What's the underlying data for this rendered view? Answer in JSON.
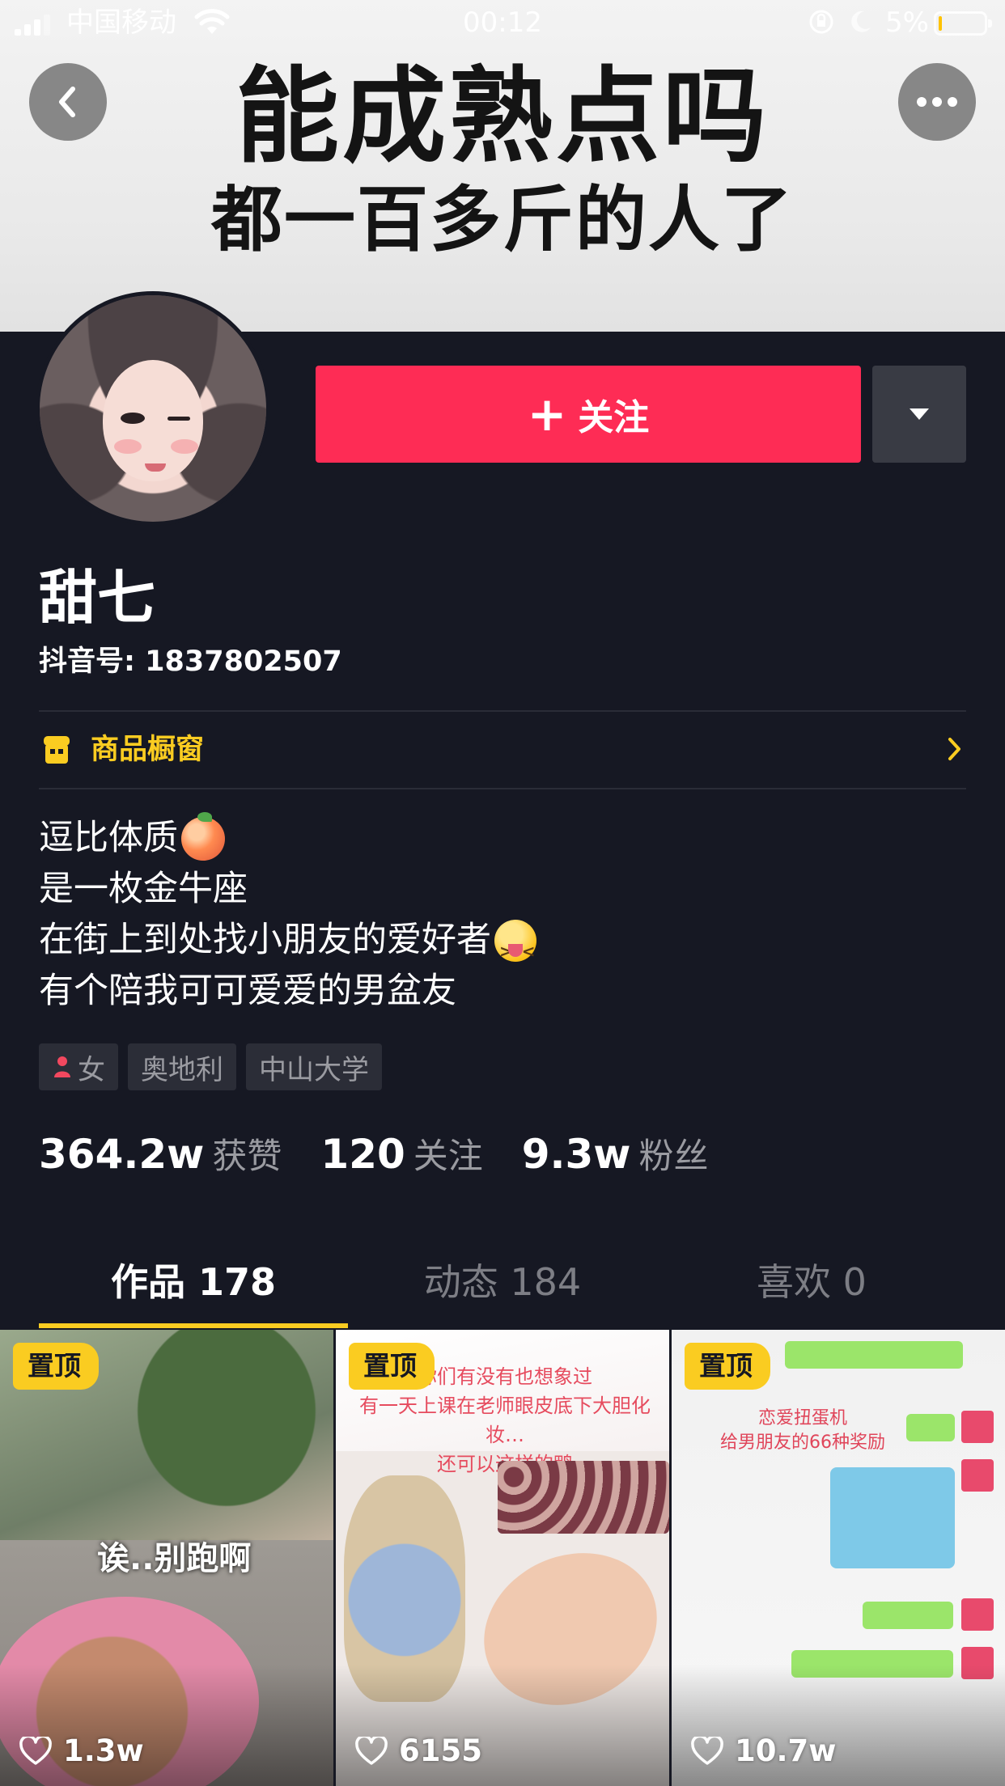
{
  "status_bar": {
    "carrier": "中国移动",
    "time": "00:12",
    "battery_percent": "5%",
    "battery_level": 0.05
  },
  "banner": {
    "line1": "能成熟点吗",
    "line2": "都一百多斤的人了"
  },
  "header": {
    "back_icon": "chevron-left-icon",
    "more_icon": "more-dots-icon"
  },
  "profile": {
    "follow_label": "关注",
    "nickname": "甜七",
    "douyin_id": "抖音号: 1837802507",
    "shop_window_label": "商品橱窗",
    "bio": [
      "逗比体质",
      "是一枚金牛座",
      "在街上到处找小朋友的爱好者",
      "有个陪我可可爱爱的男盆友"
    ],
    "tags": [
      "女",
      "奥地利",
      "中山大学"
    ],
    "stats": [
      {
        "value": "364.2w",
        "label": "获赞"
      },
      {
        "value": "120",
        "label": "关注"
      },
      {
        "value": "9.3w",
        "label": "粉丝"
      }
    ]
  },
  "tabs": [
    {
      "label": "作品 178",
      "active": true
    },
    {
      "label": "动态 184",
      "active": false
    },
    {
      "label": "喜欢 0",
      "active": false
    }
  ],
  "videos": [
    {
      "pinned_label": "置顶",
      "likes": "1.3w",
      "caption": "诶..别跑啊"
    },
    {
      "pinned_label": "置顶",
      "likes": "6155",
      "caption": "你们有没有也想象过\n有一天上课在老师眼皮底下大胆化妆…\n还可以这样的鸭"
    },
    {
      "pinned_label": "置顶",
      "likes": "10.7w",
      "caption": "恋爱扭蛋机\n给男朋友的66种奖励"
    }
  ],
  "colors": {
    "background": "#161823",
    "follow_button": "#fe2c55",
    "accent_yellow": "#facc21",
    "secondary_text": "#9a9ba1"
  }
}
